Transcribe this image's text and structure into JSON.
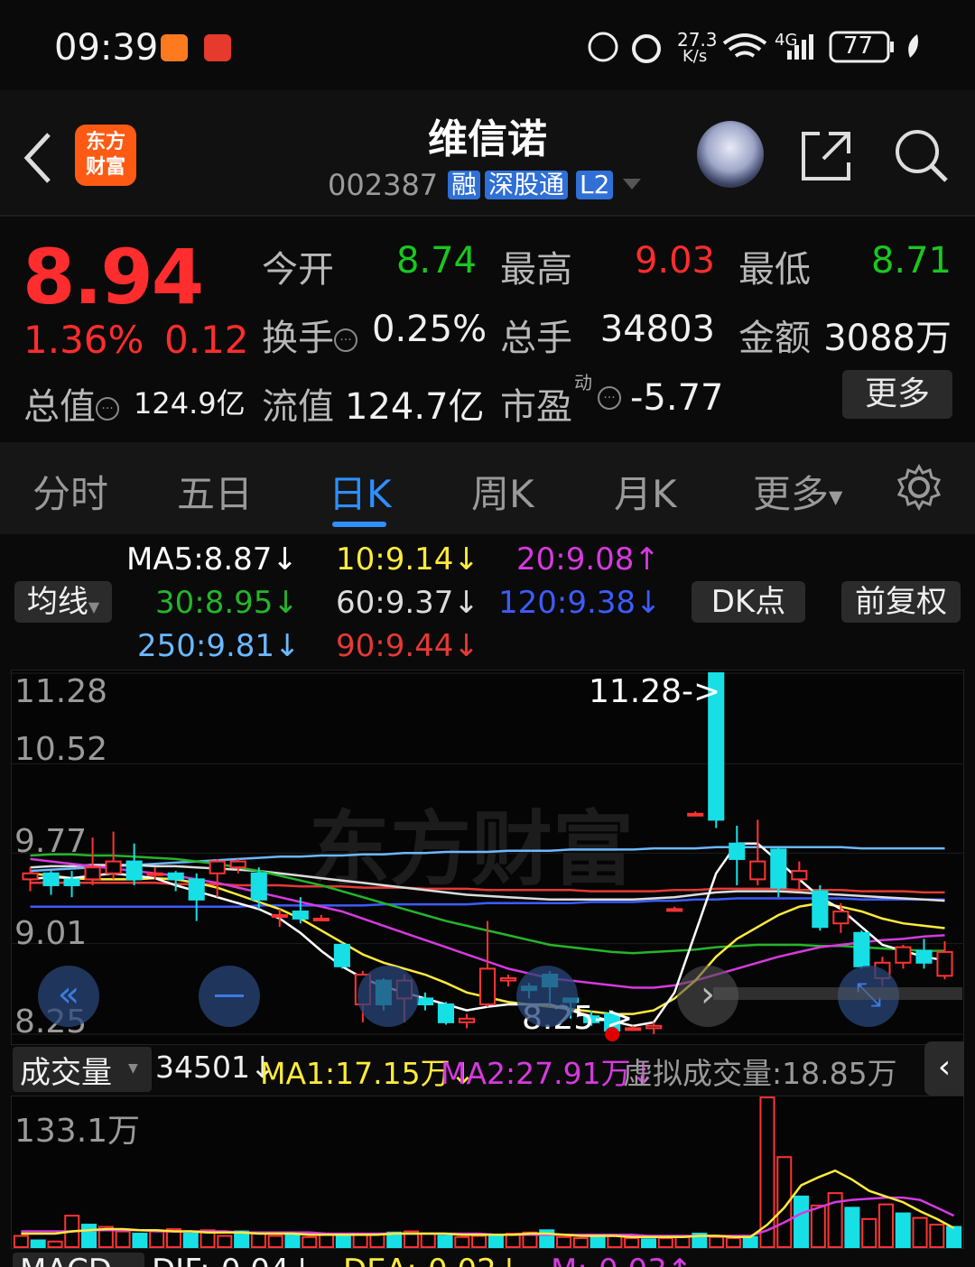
{
  "status": {
    "time": "09:39",
    "net_speed": "27.3",
    "net_unit": "K/s",
    "net_type": "4G",
    "battery": "77"
  },
  "header": {
    "logo_line1": "东方",
    "logo_line2": "财富",
    "stock_name": "维信诺",
    "stock_code": "002387",
    "tags": [
      "融",
      "深股通",
      "L2"
    ]
  },
  "quote": {
    "price": "8.94",
    "change_pct": "1.36%",
    "change": "0.12",
    "open_label": "今开",
    "open": "8.74",
    "high_label": "最高",
    "high": "9.03",
    "low_label": "最低",
    "low": "8.71",
    "turnover_label": "换手",
    "turnover": "0.25%",
    "volume_label": "总手",
    "volume": "34803",
    "amount_label": "金额",
    "amount": "3088万",
    "mktcap_label": "总值",
    "mktcap": "124.9亿",
    "float_label": "流值",
    "float_cap": "124.7亿",
    "pe_label": "市盈",
    "pe_sup": "动",
    "pe": "-5.77",
    "more_button": "更多"
  },
  "tabs": [
    "分时",
    "五日",
    "日K",
    "周K",
    "月K",
    "更多"
  ],
  "ma": {
    "selector": "均线",
    "dk_button": "DK点",
    "adjust_button": "前复权",
    "ma5": "MA5:8.87↓",
    "ma10": "10:9.14↓",
    "ma20": "20:9.08↑",
    "ma30": "30:8.95↓",
    "ma60": "60:9.37↓",
    "ma120": "120:9.38↓",
    "ma250": "250:9.81↓",
    "ma90": "90:9.44↓",
    "colors": {
      "ma5": "#ffffff",
      "ma10": "#ffeb3b",
      "ma20": "#d63adf",
      "ma30": "#25b52a",
      "ma60": "#dcdcdc",
      "ma120": "#3d5cff",
      "ma250": "#6cb8ff",
      "ma90": "#e53935"
    }
  },
  "chart_axis": {
    "y_top": "11.28",
    "y_2": "10.52",
    "y_3": "9.77",
    "y_4": "9.01",
    "y_bottom": "8.25",
    "high_marker": "11.28->",
    "low_marker": "8.25->",
    "watermark": "东方财富"
  },
  "volume": {
    "selector": "成交量",
    "value": "34501↓",
    "ma1": "MA1:17.15万↓",
    "ma2": "MA2:27.91万↓",
    "virtual": "虚拟成交量:18.85万",
    "y_top": "133.1万"
  },
  "macd_partial": {
    "label": "MACD",
    "dif": "DIF:-0.04↓",
    "dea": "DEA:-0.02↓",
    "m": "M:-0.03↑"
  },
  "chart_data": {
    "type": "candlestick",
    "ylim": [
      8.25,
      11.28
    ],
    "candles": [
      {
        "o": 9.55,
        "c": 9.6,
        "h": 9.65,
        "l": 9.45
      },
      {
        "o": 9.6,
        "c": 9.5,
        "h": 9.62,
        "l": 9.42
      },
      {
        "o": 9.55,
        "c": 9.5,
        "h": 9.62,
        "l": 9.4
      },
      {
        "o": 9.55,
        "c": 9.65,
        "h": 9.9,
        "l": 9.5
      },
      {
        "o": 9.6,
        "c": 9.7,
        "h": 9.95,
        "l": 9.55
      },
      {
        "o": 9.7,
        "c": 9.55,
        "h": 9.85,
        "l": 9.5
      },
      {
        "o": 9.6,
        "c": 9.6,
        "h": 9.65,
        "l": 9.55
      },
      {
        "o": 9.6,
        "c": 9.55,
        "h": 9.62,
        "l": 9.45
      },
      {
        "o": 9.55,
        "c": 9.38,
        "h": 9.6,
        "l": 9.2
      },
      {
        "o": 9.6,
        "c": 9.7,
        "h": 9.72,
        "l": 9.4
      },
      {
        "o": 9.65,
        "c": 9.7,
        "h": 9.72,
        "l": 9.6
      },
      {
        "o": 9.6,
        "c": 9.38,
        "h": 9.65,
        "l": 9.3
      },
      {
        "o": 9.25,
        "c": 9.25,
        "h": 9.3,
        "l": 9.15
      },
      {
        "o": 9.28,
        "c": 9.22,
        "h": 9.4,
        "l": 9.18
      },
      {
        "o": 9.22,
        "c": 9.22,
        "h": 9.25,
        "l": 9.2
      },
      {
        "o": 9.0,
        "c": 8.82,
        "h": 9.02,
        "l": 8.8
      },
      {
        "o": 8.5,
        "c": 8.75,
        "h": 8.78,
        "l": 8.35
      },
      {
        "o": 8.7,
        "c": 8.5,
        "h": 8.72,
        "l": 8.45
      },
      {
        "o": 8.55,
        "c": 8.7,
        "h": 8.75,
        "l": 8.35
      },
      {
        "o": 8.55,
        "c": 8.5,
        "h": 8.6,
        "l": 8.45
      },
      {
        "o": 8.5,
        "c": 8.35,
        "h": 8.52,
        "l": 8.33
      },
      {
        "o": 8.35,
        "c": 8.38,
        "h": 8.42,
        "l": 8.3
      },
      {
        "o": 8.5,
        "c": 8.8,
        "h": 9.2,
        "l": 8.48
      },
      {
        "o": 8.7,
        "c": 8.72,
        "h": 8.75,
        "l": 8.65
      },
      {
        "o": 8.65,
        "c": 8.62,
        "h": 8.68,
        "l": 8.55
      },
      {
        "o": 8.75,
        "c": 8.65,
        "h": 8.78,
        "l": 8.5
      },
      {
        "o": 8.55,
        "c": 8.52,
        "h": 8.55,
        "l": 8.38
      },
      {
        "o": 8.4,
        "c": 8.35,
        "h": 8.45,
        "l": 8.32
      },
      {
        "o": 8.42,
        "c": 8.28,
        "h": 8.45,
        "l": 8.25
      },
      {
        "o": 8.3,
        "c": 8.3,
        "h": 8.32,
        "l": 8.28
      },
      {
        "o": 8.3,
        "c": 8.32,
        "h": 8.35,
        "l": 8.25
      },
      {
        "o": 9.3,
        "c": 9.3,
        "h": 9.32,
        "l": 9.28
      },
      {
        "o": 10.1,
        "c": 10.1,
        "h": 10.12,
        "l": 10.08
      },
      {
        "o": 11.28,
        "c": 10.05,
        "h": 11.28,
        "l": 9.98
      },
      {
        "o": 9.85,
        "c": 9.72,
        "h": 10.0,
        "l": 9.5
      },
      {
        "o": 9.55,
        "c": 9.7,
        "h": 10.05,
        "l": 9.5
      },
      {
        "o": 9.8,
        "c": 9.48,
        "h": 9.82,
        "l": 9.4
      },
      {
        "o": 9.55,
        "c": 9.62,
        "h": 9.7,
        "l": 9.45
      },
      {
        "o": 9.45,
        "c": 9.15,
        "h": 9.5,
        "l": 9.12
      },
      {
        "o": 9.18,
        "c": 9.28,
        "h": 9.35,
        "l": 9.1
      },
      {
        "o": 9.1,
        "c": 8.82,
        "h": 9.12,
        "l": 8.8
      },
      {
        "o": 8.72,
        "c": 8.85,
        "h": 8.9,
        "l": 8.65
      },
      {
        "o": 8.85,
        "c": 8.98,
        "h": 9.0,
        "l": 8.8
      },
      {
        "o": 8.95,
        "c": 8.85,
        "h": 9.05,
        "l": 8.8
      },
      {
        "o": 8.74,
        "c": 8.94,
        "h": 9.03,
        "l": 8.71
      }
    ],
    "ma5": [
      9.55,
      9.57,
      9.56,
      9.58,
      9.6,
      9.58,
      9.56,
      9.5,
      9.45,
      9.4,
      9.35,
      9.3,
      9.22,
      9.1,
      8.95,
      8.82,
      8.72,
      8.65,
      8.6,
      8.55,
      8.5,
      8.45,
      8.48,
      8.5,
      8.5,
      8.5,
      8.45,
      8.4,
      8.36,
      8.32,
      8.35,
      8.6,
      9.1,
      9.6,
      9.85,
      9.85,
      9.7,
      9.55,
      9.4,
      9.3,
      9.15,
      9.0,
      8.95,
      8.9,
      8.87
    ],
    "ma10": [
      9.6,
      9.58,
      9.56,
      9.55,
      9.55,
      9.55,
      9.56,
      9.55,
      9.52,
      9.48,
      9.42,
      9.36,
      9.3,
      9.22,
      9.12,
      9.02,
      8.92,
      8.85,
      8.8,
      8.75,
      8.68,
      8.6,
      8.56,
      8.52,
      8.5,
      8.48,
      8.46,
      8.44,
      8.42,
      8.42,
      8.45,
      8.55,
      8.7,
      8.9,
      9.05,
      9.15,
      9.25,
      9.32,
      9.35,
      9.32,
      9.28,
      9.22,
      9.18,
      9.16,
      9.14
    ],
    "ma20": [
      9.72,
      9.7,
      9.68,
      9.66,
      9.64,
      9.62,
      9.6,
      9.58,
      9.55,
      9.52,
      9.48,
      9.44,
      9.4,
      9.36,
      9.32,
      9.28,
      9.22,
      9.16,
      9.1,
      9.04,
      8.98,
      8.92,
      8.86,
      8.8,
      8.76,
      8.72,
      8.7,
      8.68,
      8.66,
      8.64,
      8.64,
      8.66,
      8.7,
      8.75,
      8.8,
      8.85,
      8.9,
      8.94,
      8.98,
      9.0,
      9.02,
      9.04,
      9.05,
      9.07,
      9.08
    ],
    "ma30": [
      9.75,
      9.76,
      9.76,
      9.75,
      9.75,
      9.74,
      9.73,
      9.72,
      9.7,
      9.68,
      9.65,
      9.62,
      9.58,
      9.54,
      9.5,
      9.45,
      9.4,
      9.35,
      9.3,
      9.25,
      9.2,
      9.16,
      9.12,
      9.08,
      9.04,
      9.0,
      8.98,
      8.96,
      8.94,
      8.93,
      8.94,
      8.95,
      8.96,
      8.98,
      8.99,
      9.0,
      9.0,
      9.0,
      8.99,
      8.99,
      8.98,
      8.97,
      8.96,
      8.95,
      8.95
    ],
    "ma60": [
      9.65,
      9.66,
      9.66,
      9.67,
      9.67,
      9.67,
      9.66,
      9.66,
      9.65,
      9.64,
      9.63,
      9.62,
      9.6,
      9.58,
      9.56,
      9.54,
      9.52,
      9.5,
      9.48,
      9.46,
      9.44,
      9.42,
      9.41,
      9.4,
      9.39,
      9.38,
      9.38,
      9.38,
      9.38,
      9.38,
      9.39,
      9.4,
      9.42,
      9.44,
      9.45,
      9.45,
      9.45,
      9.44,
      9.43,
      9.42,
      9.41,
      9.4,
      9.39,
      9.38,
      9.37
    ],
    "ma90": [
      9.52,
      9.52,
      9.52,
      9.52,
      9.52,
      9.52,
      9.52,
      9.51,
      9.51,
      9.51,
      9.5,
      9.5,
      9.5,
      9.49,
      9.49,
      9.49,
      9.48,
      9.48,
      9.48,
      9.47,
      9.47,
      9.47,
      9.46,
      9.46,
      9.46,
      9.46,
      9.46,
      9.45,
      9.45,
      9.45,
      9.45,
      9.46,
      9.46,
      9.47,
      9.47,
      9.47,
      9.47,
      9.46,
      9.46,
      9.46,
      9.45,
      9.45,
      9.45,
      9.44,
      9.44
    ],
    "ma120": [
      9.32,
      9.32,
      9.32,
      9.32,
      9.32,
      9.32,
      9.32,
      9.32,
      9.32,
      9.32,
      9.32,
      9.33,
      9.33,
      9.33,
      9.33,
      9.33,
      9.33,
      9.34,
      9.34,
      9.34,
      9.34,
      9.34,
      9.35,
      9.35,
      9.35,
      9.35,
      9.35,
      9.36,
      9.36,
      9.36,
      9.37,
      9.37,
      9.38,
      9.38,
      9.39,
      9.39,
      9.39,
      9.39,
      9.39,
      9.39,
      9.38,
      9.38,
      9.38,
      9.38,
      9.38
    ],
    "ma250": [
      9.62,
      9.63,
      9.64,
      9.65,
      9.66,
      9.67,
      9.68,
      9.69,
      9.7,
      9.71,
      9.72,
      9.73,
      9.74,
      9.74,
      9.75,
      9.75,
      9.76,
      9.76,
      9.77,
      9.77,
      9.78,
      9.78,
      9.78,
      9.79,
      9.79,
      9.79,
      9.8,
      9.8,
      9.8,
      9.8,
      9.81,
      9.81,
      9.81,
      9.82,
      9.82,
      9.82,
      9.82,
      9.82,
      9.82,
      9.82,
      9.81,
      9.81,
      9.81,
      9.81,
      9.81
    ],
    "volumes": [
      10,
      6,
      5,
      28,
      20,
      18,
      14,
      12,
      14,
      16,
      12,
      15,
      10,
      14,
      12,
      10,
      11,
      9,
      12,
      11,
      11,
      12,
      13,
      14,
      12,
      10,
      9,
      10,
      11,
      12,
      13,
      15,
      9,
      8,
      9,
      10,
      8,
      7,
      8,
      9,
      12,
      9,
      8,
      9,
      133,
      80,
      45,
      37,
      48,
      35,
      25,
      38,
      30,
      26,
      20,
      18
    ],
    "vol_ma1": [
      12,
      12,
      12,
      14,
      15,
      16,
      16,
      15,
      15,
      14,
      14,
      13,
      13,
      13,
      12,
      12,
      12,
      11,
      11,
      11,
      11,
      11,
      12,
      12,
      12,
      12,
      11,
      11,
      11,
      11,
      12,
      12,
      11,
      10,
      10,
      10,
      9,
      9,
      9,
      9,
      10,
      10,
      9,
      9,
      20,
      35,
      55,
      62,
      68,
      60,
      50,
      45,
      40,
      32,
      25,
      17
    ],
    "vol_ma2": [
      14,
      14,
      14,
      14,
      15,
      15,
      15,
      15,
      14,
      14,
      14,
      14,
      14,
      13,
      13,
      13,
      13,
      13,
      12,
      12,
      12,
      12,
      12,
      12,
      12,
      12,
      12,
      12,
      11,
      11,
      11,
      11,
      11,
      11,
      11,
      11,
      11,
      10,
      10,
      10,
      10,
      10,
      10,
      10,
      15,
      22,
      30,
      35,
      40,
      42,
      43,
      44,
      44,
      42,
      35,
      28
    ],
    "vol_ylim": [
      0,
      133.1
    ]
  }
}
